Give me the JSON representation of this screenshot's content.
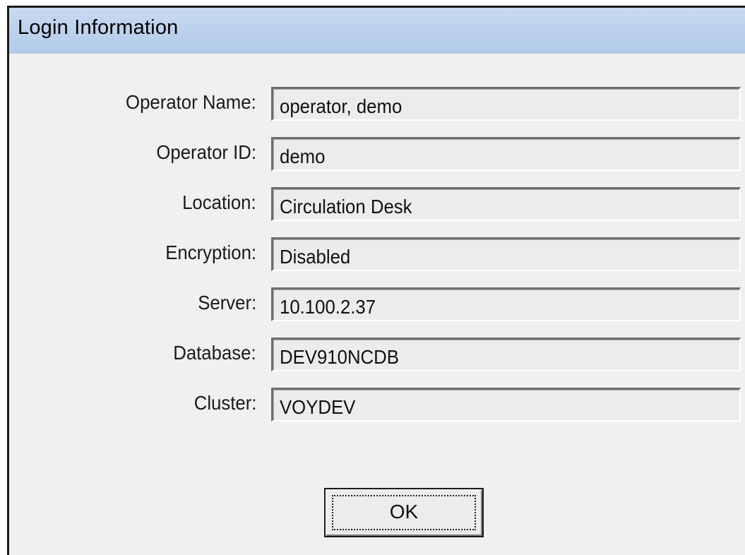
{
  "window": {
    "title": "Login Information"
  },
  "fields": [
    {
      "label": "Operator Name:",
      "value": "operator, demo"
    },
    {
      "label": "Operator ID:",
      "value": "demo"
    },
    {
      "label": "Location:",
      "value": "Circulation Desk"
    },
    {
      "label": "Encryption:",
      "value": "Disabled"
    },
    {
      "label": "Server:",
      "value": "10.100.2.37"
    },
    {
      "label": "Database:",
      "value": "DEV910NCDB"
    },
    {
      "label": "Cluster:",
      "value": "VOYDEV"
    }
  ],
  "buttons": {
    "ok_label": "OK"
  }
}
